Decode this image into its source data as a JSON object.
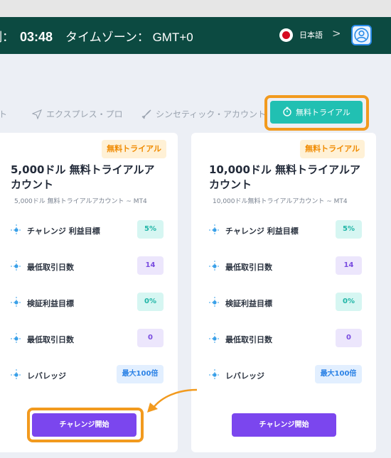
{
  "header": {
    "clock_prefix": "制",
    "colon": "：",
    "time": "03:48",
    "timezone": "タイムゾーン： GMT+0",
    "language": "日本語",
    "chevron": ">"
  },
  "tabs": [
    {
      "label": "ト",
      "icon": "none"
    },
    {
      "label": "エクスプレス・プロ",
      "icon": "plane-icon"
    },
    {
      "label": "シンセティック・アカウント",
      "icon": "rocket-icon"
    },
    {
      "label": "無料トライアル",
      "icon": "timer-icon",
      "active": true
    }
  ],
  "cards": [
    {
      "badge": "無料トライアル",
      "title": "5,000ドル 無料トライアルアカウント",
      "subtitle": "5,000ドル 無料トライアルアカウント ~ MT4",
      "rows": [
        {
          "label": "チャレンジ 利益目標",
          "value": "5%"
        },
        {
          "label": "最低取引日数",
          "value": "14"
        },
        {
          "label": "検証利益目標",
          "value": "0%"
        },
        {
          "label": "最低取引日数",
          "value": "0"
        },
        {
          "label": "レバレッジ",
          "value": "最大100倍"
        }
      ],
      "button": "チャレンジ開始"
    },
    {
      "badge": "無料トライアル",
      "title": "10,000ドル 無料トライアルアカウント",
      "subtitle": "10,000ドル無料トライアルアカウント ~ MT4",
      "rows": [
        {
          "label": "チャレンジ 利益目標",
          "value": "5%"
        },
        {
          "label": "最低取引日数",
          "value": "14"
        },
        {
          "label": "検証利益目標",
          "value": "0%"
        },
        {
          "label": "最低取引日数",
          "value": "0"
        },
        {
          "label": "レバレッジ",
          "value": "最大100倍"
        }
      ],
      "button": "チャレンジ開始"
    }
  ],
  "colors": {
    "header_bg": "#0c4a41",
    "accent_teal": "#21c0b2",
    "button_purple": "#7b46ee",
    "highlight_orange": "#f29a1e",
    "badge_orange": "#f08a00"
  }
}
